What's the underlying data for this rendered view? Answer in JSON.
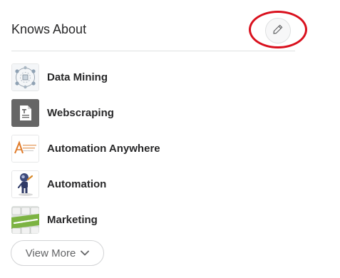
{
  "section": {
    "title": "Knows About",
    "edit_icon": "pencil-icon"
  },
  "topics": [
    {
      "label": "Data Mining",
      "icon": "data-mining-thumbnail"
    },
    {
      "label": "Webscraping",
      "icon": "document-thumbnail"
    },
    {
      "label": "Automation Anywhere",
      "icon": "automation-anywhere-logo"
    },
    {
      "label": "Automation",
      "icon": "robot-thumbnail"
    },
    {
      "label": "Marketing",
      "icon": "keyboard-marketing-thumbnail"
    }
  ],
  "view_more": {
    "label": "View More",
    "icon": "chevron-down-icon"
  },
  "colors": {
    "text": "#282829",
    "muted_text": "#636466",
    "divider": "#dee0e1",
    "highlight": "#d9101d"
  }
}
